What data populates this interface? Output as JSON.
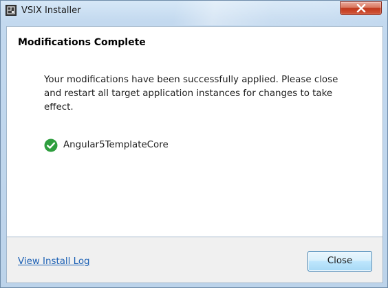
{
  "window": {
    "title": "VSIX Installer",
    "close_icon": "close-x"
  },
  "content": {
    "heading": "Modifications Complete",
    "message": "Your modifications have been successfully applied. Please close and restart all target application instances for changes to take effect.",
    "items": [
      {
        "status_icon": "green-checkmark",
        "label": "Angular5TemplateCore"
      }
    ]
  },
  "footer": {
    "log_link": "View Install Log",
    "close_button": "Close"
  },
  "colors": {
    "accent": "#3c7fb1",
    "success": "#2e9e3e",
    "link": "#1a5fb4",
    "close_button_red": "#c0391c"
  }
}
